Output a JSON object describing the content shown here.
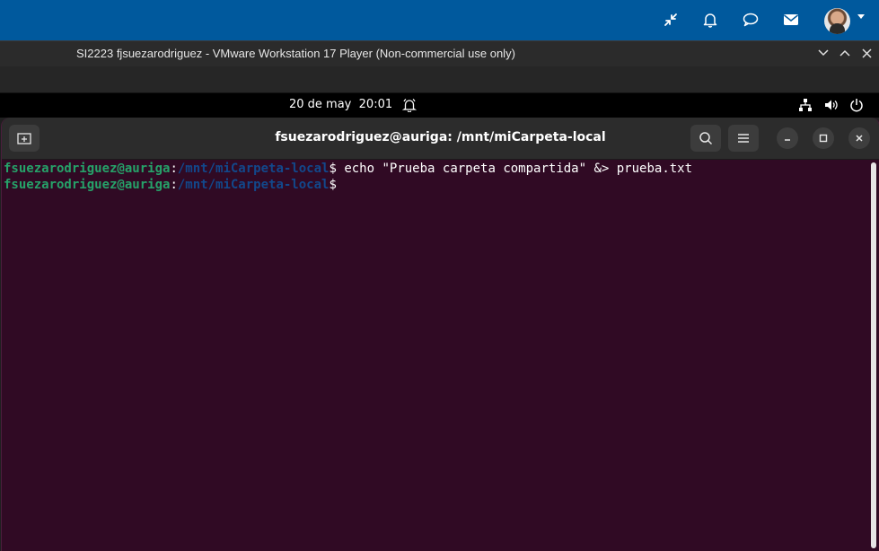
{
  "host_bar": {
    "icons": [
      "collapse-icon",
      "bell-icon",
      "chat-icon",
      "mail-icon"
    ],
    "accent": "#00599d"
  },
  "vm_window": {
    "title": "SI2223 fjsuezarodriguez - VMware Workstation 17 Player (Non-commercial use only)"
  },
  "gnome_panel": {
    "date": "20 de may",
    "time": "20:01",
    "tray_icons": [
      "network-icon",
      "volume-icon",
      "power-icon"
    ]
  },
  "terminal": {
    "title": "fsuezarodriguez@auriga: /mnt/miCarpeta-local",
    "lines": [
      {
        "user": "fsuezarodriguez@auriga",
        "sep": ":",
        "path": "/mnt/miCarpeta-local",
        "prompt": "$ ",
        "command": "echo \"Prueba carpeta compartida\" &> prueba.txt"
      },
      {
        "user": "fsuezarodriguez@auriga",
        "sep": ":",
        "path": "/mnt/miCarpeta-local",
        "prompt": "$",
        "command": ""
      }
    ],
    "colors": {
      "background": "#300a24",
      "user": "#26a269",
      "path": "#12488b"
    }
  }
}
